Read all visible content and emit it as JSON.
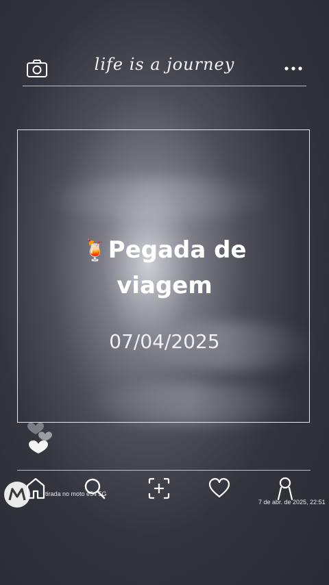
{
  "header": {
    "brand": "life is a journey",
    "camera_icon": "camera-icon",
    "more_icon": "more-dots-icon"
  },
  "post": {
    "emoji": "🍹",
    "title_line1": "Pegada de",
    "title_line2": "viagem",
    "date": "07/04/2025"
  },
  "nav": {
    "items": [
      "home-icon",
      "search-icon",
      "add-post-icon",
      "heart-icon",
      "profile-icon"
    ]
  },
  "watermark": {
    "left_text": "tirada no moto e54 5G",
    "right_text": "7 de abr. de 2025, 22:51"
  }
}
